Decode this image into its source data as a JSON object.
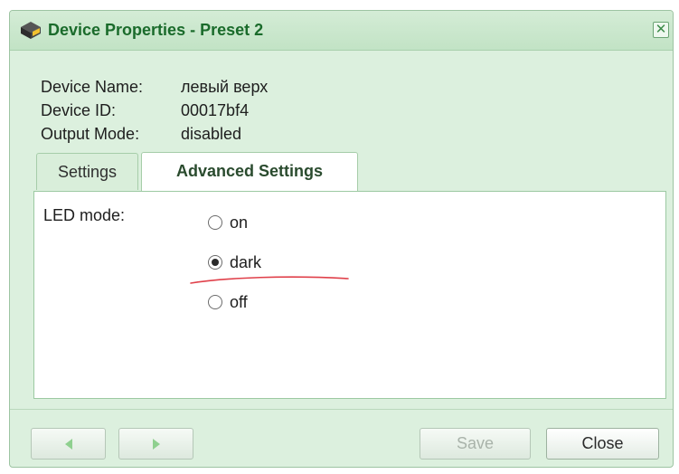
{
  "window": {
    "title": "Device Properties - Preset 2",
    "close_glyph": "✕",
    "icon": "device-icon"
  },
  "info": [
    {
      "label": "Device Name:",
      "value": "левый верх"
    },
    {
      "label": "Device ID:",
      "value": "00017bf4"
    },
    {
      "label": "Output Mode:",
      "value": "disabled"
    }
  ],
  "tabs": [
    {
      "label": "Settings",
      "active": false
    },
    {
      "label": "Advanced Settings",
      "active": true
    }
  ],
  "led": {
    "label": "LED mode:",
    "options": [
      {
        "label": "on",
        "checked": false
      },
      {
        "label": "dark",
        "checked": true
      },
      {
        "label": "off",
        "checked": false
      }
    ]
  },
  "buttons": {
    "prev_icon": "arrow-left-icon",
    "next_icon": "arrow-right-icon",
    "save": "Save",
    "close": "Close"
  },
  "colors": {
    "accent": "#1a6b2b",
    "dialog_bg": "#dcf0de",
    "annotation": "#e0404a"
  }
}
